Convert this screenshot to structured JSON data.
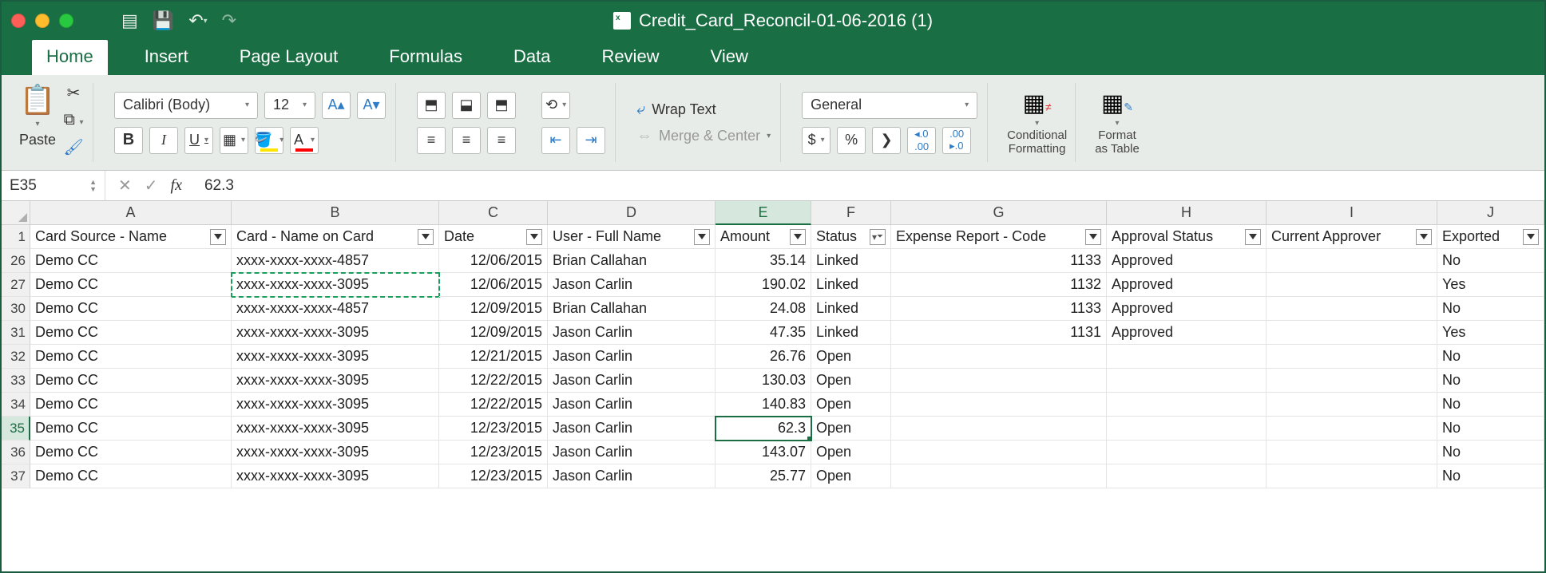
{
  "window": {
    "title": "Credit_Card_Reconcil-01-06-2016 (1)"
  },
  "tabs": {
    "home": "Home",
    "insert": "Insert",
    "pagelayout": "Page Layout",
    "formulas": "Formulas",
    "data": "Data",
    "review": "Review",
    "view": "View"
  },
  "ribbon": {
    "paste": "Paste",
    "font_name": "Calibri (Body)",
    "font_size": "12",
    "wrap_text": "Wrap Text",
    "merge_center": "Merge & Center",
    "number_format": "General",
    "conditional_formatting": "Conditional\nFormatting",
    "format_as_table": "Format\nas Table"
  },
  "formula_bar": {
    "name_box": "E35",
    "value": "62.3"
  },
  "columns": [
    "A",
    "B",
    "C",
    "D",
    "E",
    "F",
    "G",
    "H",
    "I",
    "J"
  ],
  "headers": {
    "A": "Card Source - Name",
    "B": "Card - Name on Card",
    "C": "Date",
    "D": "User - Full Name",
    "E": "Amount",
    "F": "Status",
    "G": "Expense Report - Code",
    "H": "Approval Status",
    "I": "Current Approver",
    "J": "Exported"
  },
  "rows": [
    {
      "n": 26,
      "A": "Demo CC",
      "B": "xxxx-xxxx-xxxx-4857",
      "C": "12/06/2015",
      "D": "Brian Callahan",
      "E": "35.14",
      "F": "Linked",
      "G": "1133",
      "H": "Approved",
      "I": "",
      "J": "No"
    },
    {
      "n": 27,
      "A": "Demo CC",
      "B": "xxxx-xxxx-xxxx-3095",
      "C": "12/06/2015",
      "D": "Jason Carlin",
      "E": "190.02",
      "F": "Linked",
      "G": "1132",
      "H": "Approved",
      "I": "",
      "J": "Yes"
    },
    {
      "n": 30,
      "A": "Demo CC",
      "B": "xxxx-xxxx-xxxx-4857",
      "C": "12/09/2015",
      "D": "Brian Callahan",
      "E": "24.08",
      "F": "Linked",
      "G": "1133",
      "H": "Approved",
      "I": "",
      "J": "No"
    },
    {
      "n": 31,
      "A": "Demo CC",
      "B": "xxxx-xxxx-xxxx-3095",
      "C": "12/09/2015",
      "D": "Jason Carlin",
      "E": "47.35",
      "F": "Linked",
      "G": "1131",
      "H": "Approved",
      "I": "",
      "J": "Yes"
    },
    {
      "n": 32,
      "A": "Demo CC",
      "B": "xxxx-xxxx-xxxx-3095",
      "C": "12/21/2015",
      "D": "Jason Carlin",
      "E": "26.76",
      "F": "Open",
      "G": "",
      "H": "",
      "I": "",
      "J": "No"
    },
    {
      "n": 33,
      "A": "Demo CC",
      "B": "xxxx-xxxx-xxxx-3095",
      "C": "12/22/2015",
      "D": "Jason Carlin",
      "E": "130.03",
      "F": "Open",
      "G": "",
      "H": "",
      "I": "",
      "J": "No"
    },
    {
      "n": 34,
      "A": "Demo CC",
      "B": "xxxx-xxxx-xxxx-3095",
      "C": "12/22/2015",
      "D": "Jason Carlin",
      "E": "140.83",
      "F": "Open",
      "G": "",
      "H": "",
      "I": "",
      "J": "No"
    },
    {
      "n": 35,
      "A": "Demo CC",
      "B": "xxxx-xxxx-xxxx-3095",
      "C": "12/23/2015",
      "D": "Jason Carlin",
      "E": "62.3",
      "F": "Open",
      "G": "",
      "H": "",
      "I": "",
      "J": "No"
    },
    {
      "n": 36,
      "A": "Demo CC",
      "B": "xxxx-xxxx-xxxx-3095",
      "C": "12/23/2015",
      "D": "Jason Carlin",
      "E": "143.07",
      "F": "Open",
      "G": "",
      "H": "",
      "I": "",
      "J": "No"
    },
    {
      "n": 37,
      "A": "Demo CC",
      "B": "xxxx-xxxx-xxxx-3095",
      "C": "12/23/2015",
      "D": "Jason Carlin",
      "E": "25.77",
      "F": "Open",
      "G": "",
      "H": "",
      "I": "",
      "J": "No"
    }
  ],
  "active": {
    "col": "E",
    "row": 35
  },
  "copied_cell": "B27",
  "filter_applied_col": "F"
}
